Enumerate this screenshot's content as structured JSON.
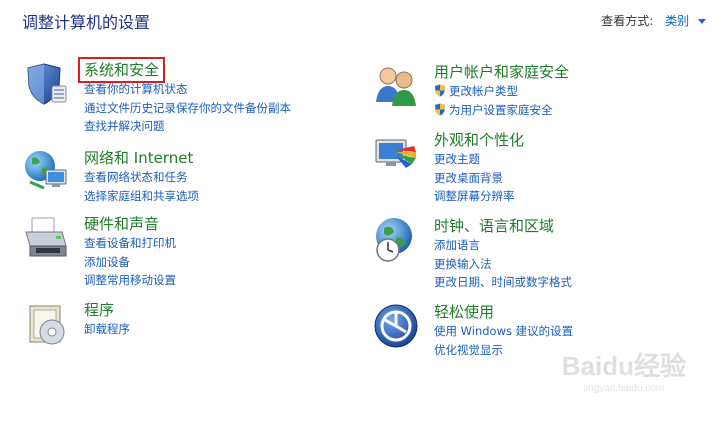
{
  "header": {
    "title": "调整计算机的设置",
    "view_by_label": "查看方式:",
    "view_by_value": "类别"
  },
  "categories_left": [
    {
      "title": "系统和安全",
      "icon": "shield-icon",
      "links": [
        "查看你的计算机状态",
        "通过文件历史记录保存你的文件备份副本",
        "查找并解决问题"
      ]
    },
    {
      "title": "网络和 Internet",
      "icon": "network-globe-icon",
      "links": [
        "查看网络状态和任务",
        "选择家庭组和共享选项"
      ]
    },
    {
      "title": "硬件和声音",
      "icon": "printer-icon",
      "links": [
        "查看设备和打印机",
        "添加设备",
        "调整常用移动设置"
      ]
    },
    {
      "title": "程序",
      "icon": "programs-icon",
      "links": [
        "卸载程序"
      ]
    }
  ],
  "categories_right": [
    {
      "title": "用户帐户和家庭安全",
      "icon": "users-icon",
      "links": [
        "更改帐户类型",
        "为用户设置家庭安全"
      ]
    },
    {
      "title": "外观和个性化",
      "icon": "appearance-icon",
      "links": [
        "更改主题",
        "更改桌面背景",
        "调整屏幕分辨率"
      ]
    },
    {
      "title": "时钟、语言和区域",
      "icon": "clock-globe-icon",
      "links": [
        "添加语言",
        "更换输入法",
        "更改日期、时间或数字格式"
      ]
    },
    {
      "title": "轻松使用",
      "icon": "ease-of-access-icon",
      "links": [
        "使用 Windows 建议的设置",
        "优化视觉显示"
      ]
    }
  ],
  "watermark": {
    "text": "Baidu经验",
    "sub": "jingyan.baidu.com"
  }
}
